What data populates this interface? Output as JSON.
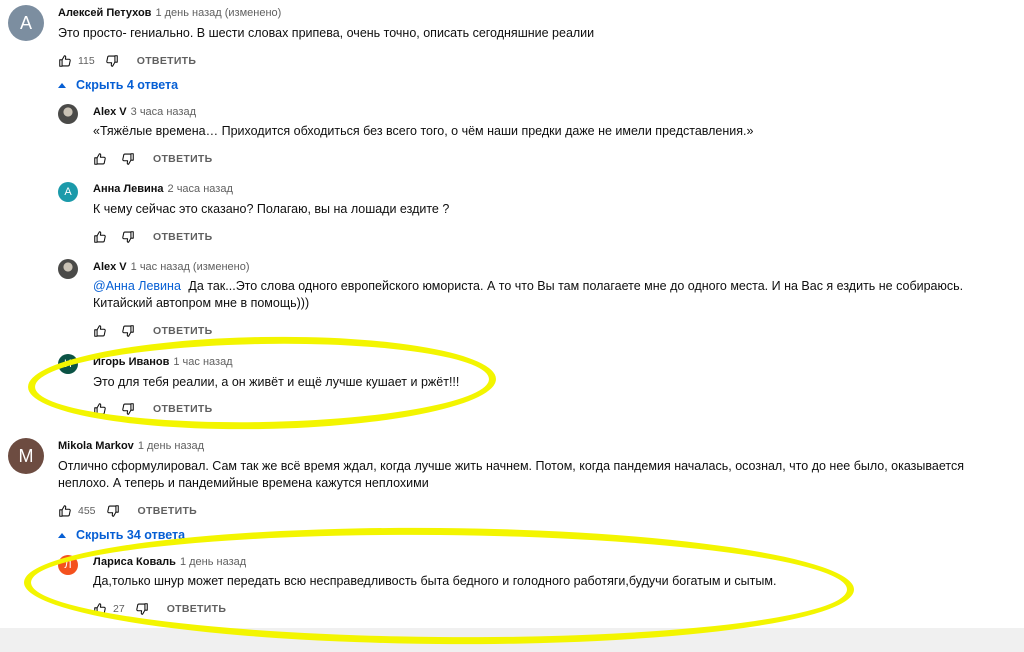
{
  "colors": {
    "link": "#065fd4",
    "highlight": "#f3f500"
  },
  "comments": [
    {
      "avatar_letter": "А",
      "avatar_color": "#7c8ea0",
      "author": "Алексей Петухов",
      "timestamp": "1 день назад (изменено)",
      "text": "Это просто- гениально. В шести словах припева, очень точно, описать сегодняшние реалии",
      "likes": "115",
      "reply_label": "ОТВЕТИТЬ",
      "toggle": "Скрыть 4 ответа",
      "replies": [
        {
          "avatar_letter": "",
          "avatar_color": "#4a4a48",
          "author": "Alex V",
          "timestamp": "3 часа назад",
          "text": "«Тяжёлые времена… Приходится обходиться без всего того, о чём наши предки даже не имели представления.»",
          "reply_label": "ОТВЕТИТЬ"
        },
        {
          "avatar_letter": "А",
          "avatar_color": "#1b9aaa",
          "author": "Анна Левина",
          "timestamp": "2 часа назад",
          "text": "К чему сейчас это сказано? Полагаю, вы на лошади ездите ?",
          "reply_label": "ОТВЕТИТЬ"
        },
        {
          "avatar_letter": "",
          "avatar_color": "#4a4a48",
          "author": "Alex V",
          "timestamp": "1 час назад (изменено)",
          "mention": "@Анна Левина",
          "text": "Да так...Это слова одного европейского юмориста. А то что Вы там полагаете мне до одного места. И на Вас я ездить не собираюсь. Китайский автопром мне в помощь)))",
          "reply_label": "ОТВЕТИТЬ"
        },
        {
          "avatar_letter": "И",
          "avatar_color": "#0b5345",
          "author": "Игорь Иванов",
          "timestamp": "1 час назад",
          "text": "Это для тебя реалии, а он живёт и ещё лучше кушает и ржёт!!!",
          "reply_label": "ОТВЕТИТЬ"
        }
      ]
    },
    {
      "avatar_letter": "M",
      "avatar_color": "#6d4c41",
      "author": "Mikola Markov",
      "timestamp": "1 день назад",
      "text": "Отлично сформулировал. Сам так же всё время ждал, когда лучше жить начнем. Потом, когда пандемия началась, осознал, что до нее было, оказывается неплохо. А теперь и пандемийные времена кажутся неплохими",
      "likes": "455",
      "reply_label": "ОТВЕТИТЬ",
      "toggle": "Скрыть 34 ответа",
      "replies": [
        {
          "avatar_letter": "Л",
          "avatar_color": "#f4511e",
          "author": "Лариса Коваль",
          "timestamp": "1 день назад",
          "text": "Да,только шнур может передать всю несправедливость быта бедного и голодного работяги,будучи богатым и сытым.",
          "likes": "27",
          "reply_label": "ОТВЕТИТЬ"
        }
      ]
    }
  ]
}
